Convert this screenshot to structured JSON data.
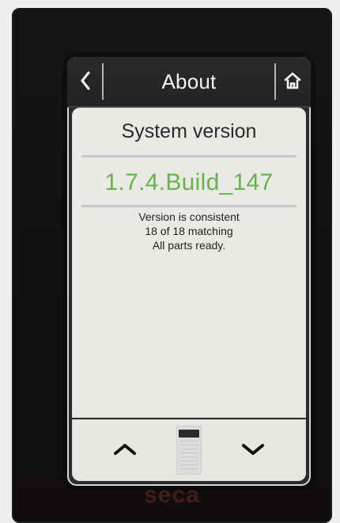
{
  "header": {
    "back_icon": "back-icon",
    "title": "About",
    "home_icon": "home-icon"
  },
  "main": {
    "system_title": "System version",
    "version": "1.7.4.Build_147",
    "status_lines": [
      "Version is consistent",
      "18 of 18 matching",
      "All parts ready."
    ],
    "accent_color": "#66b44a"
  },
  "bottom": {
    "up_icon": "chevron-up-icon",
    "down_icon": "chevron-down-icon",
    "scroll_indicator_icon": "scroll-indicator"
  },
  "device": {
    "brand": "seca"
  }
}
